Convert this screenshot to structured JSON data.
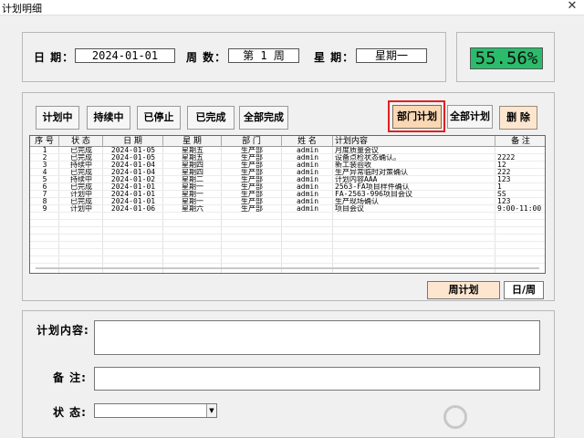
{
  "window": {
    "title": "计划明细",
    "close_icon": "close-icon"
  },
  "header": {
    "date_label": "日 期：",
    "date_value": "2024-01-01",
    "week_label": "周 数：",
    "week_value": "第 1 周",
    "weekday_label": "星 期：",
    "weekday_value": "星期一",
    "percent": "55.56%",
    "percent_color": "#2bbc6b"
  },
  "filters": {
    "planning": "计划中",
    "ongoing": "持续中",
    "stopped": "已停止",
    "done": "已完成",
    "all_done": "全部完成",
    "dept_plan": "部门计划",
    "all_plan": "全部计划",
    "delete": "删 除"
  },
  "table": {
    "columns": [
      "序 号",
      "状 态",
      "日 期",
      "星 期",
      "部 门",
      "姓 名",
      "计划内容",
      "备 注"
    ],
    "rows": [
      [
        "1",
        "已完成",
        "2024-01-05",
        "星期五",
        "生产部",
        "admin",
        "月度质量会议",
        ""
      ],
      [
        "2",
        "已完成",
        "2024-01-05",
        "星期五",
        "生产部",
        "admin",
        "设备点检状态确认。",
        "2222"
      ],
      [
        "3",
        "持续中",
        "2024-01-04",
        "星期四",
        "生产部",
        "admin",
        "新工装验收",
        "12"
      ],
      [
        "4",
        "已完成",
        "2024-01-04",
        "星期四",
        "生产部",
        "admin",
        "生产异常临时对策确认",
        "222"
      ],
      [
        "5",
        "持续中",
        "2024-01-02",
        "星期二",
        "生产部",
        "admin",
        "计划内容AAA",
        "123"
      ],
      [
        "6",
        "已完成",
        "2024-01-01",
        "星期一",
        "生产部",
        "admin",
        "2563-FA项目样件确认",
        "1"
      ],
      [
        "7",
        "计划中",
        "2024-01-01",
        "星期一",
        "生产部",
        "admin",
        "FA-2563-996项目会议",
        "SS"
      ],
      [
        "8",
        "已完成",
        "2024-01-01",
        "星期一",
        "生产部",
        "admin",
        "生产现场确认",
        "123"
      ],
      [
        "9",
        "计划中",
        "2024-01-06",
        "星期六",
        "生产部",
        "admin",
        "项目会议",
        "9:00-11:00"
      ]
    ]
  },
  "view": {
    "week_plan": "周计划",
    "day_week": "日/周"
  },
  "form": {
    "content_label": "计划内容:",
    "remark_label": "备 注:",
    "status_label": "状 态:",
    "content_value": "",
    "remark_value": "",
    "status_value": ""
  },
  "watermark": {
    "text": ""
  }
}
